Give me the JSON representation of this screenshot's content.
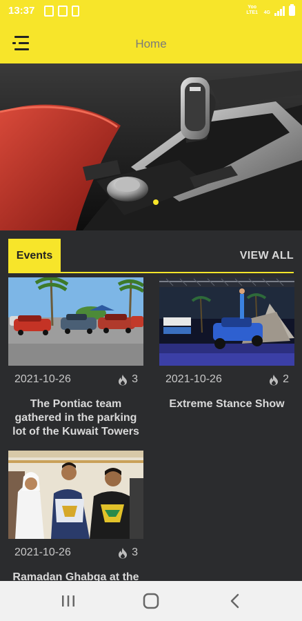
{
  "status_bar": {
    "time": "13:37",
    "network_labels": [
      "Yoo LTE1",
      "4G"
    ],
    "icons": [
      "shield-check-icon",
      "sim-icon",
      "sd-card-icon",
      "signal-icon",
      "battery-icon"
    ]
  },
  "app_bar": {
    "title": "Home",
    "menu_icon": "menu-icon",
    "background": "#f7e52a"
  },
  "hero": {
    "description_icon": "car-gear-shifter-image"
  },
  "events": {
    "tab_label": "Events",
    "view_all_label": "VIEW ALL",
    "accent": "#f7e52a",
    "items": [
      {
        "date": "2021-10-26",
        "count": "3",
        "title": "The Pontiac team gathered in the parking lot of the Kuwait Towers"
      },
      {
        "date": "2021-10-26",
        "count": "2",
        "title": "Extreme Stance Show"
      },
      {
        "date": "2021-10-26",
        "count": "3",
        "title": "Ramadan Ghabga at the"
      }
    ]
  },
  "nav_bar": {
    "icons": [
      "recent-apps-icon",
      "home-icon",
      "back-icon"
    ]
  }
}
